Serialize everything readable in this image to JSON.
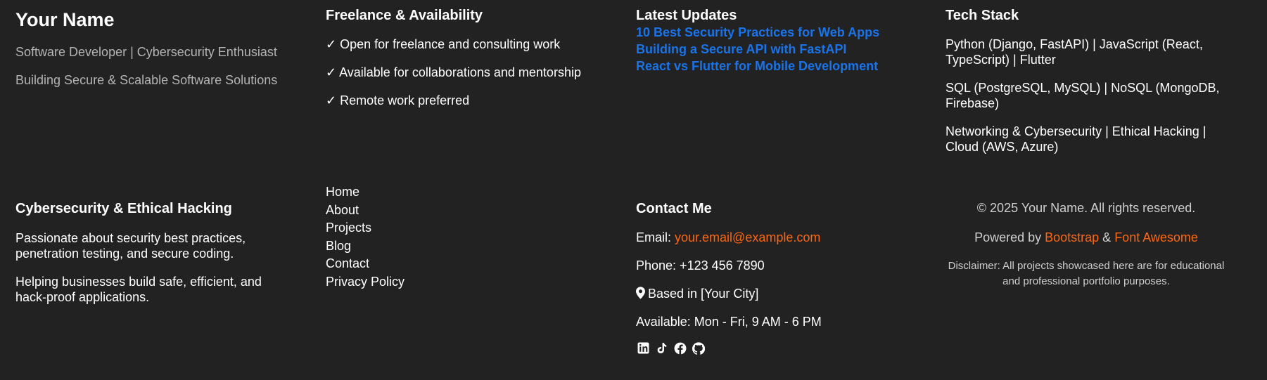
{
  "brand": {
    "name": "Your Name",
    "tagline": "Software Developer | Cybersecurity Enthusiast",
    "subtagline": "Building Secure & Scalable Software Solutions"
  },
  "freelance": {
    "title": "Freelance & Availability",
    "items": [
      "✓ Open for freelance and consulting work",
      "✓ Available for collaborations and mentorship",
      "✓ Remote work preferred"
    ]
  },
  "updates": {
    "title": "Latest Updates",
    "links": [
      "10 Best Security Practices for Web Apps",
      "Building a Secure API with FastAPI",
      "React vs Flutter for Mobile Development"
    ]
  },
  "tech": {
    "title": "Tech Stack",
    "items": [
      "Python (Django, FastAPI) | JavaScript (React, TypeScript) | Flutter",
      "SQL (PostgreSQL, MySQL) | NoSQL (MongoDB, Firebase)",
      "Networking & Cybersecurity | Ethical Hacking | Cloud (AWS, Azure)"
    ]
  },
  "cyber": {
    "title": "Cybersecurity & Ethical Hacking",
    "paragraphs": [
      "Passionate about security best practices, penetration testing, and secure coding.",
      "Helping businesses build safe, efficient, and hack-proof applications."
    ]
  },
  "nav": {
    "links": [
      "Home",
      "About",
      "Projects",
      "Blog",
      "Contact",
      "Privacy Policy"
    ]
  },
  "contact": {
    "title": "Contact Me",
    "email_label": "Email: ",
    "email": "your.email@example.com",
    "phone": "Phone: +123 456 7890",
    "location": "Based in [Your City]",
    "hours": "Available: Mon - Fri, 9 AM - 6 PM",
    "social": [
      "linkedin-icon",
      "tiktok-icon",
      "facebook-icon",
      "github-icon"
    ]
  },
  "legal": {
    "copyright": "© 2025 Your Name. All rights reserved.",
    "powered_prefix": "Powered by ",
    "powered_a": "Bootstrap",
    "powered_sep": " & ",
    "powered_b": "Font Awesome",
    "disclaimer": "Disclaimer: All projects showcased here are for educational and professional portfolio purposes."
  },
  "colors": {
    "background": "#222222",
    "link_blue": "#1a73e8",
    "accent_orange": "#fd6613",
    "muted_text": "#b4b4b4"
  }
}
